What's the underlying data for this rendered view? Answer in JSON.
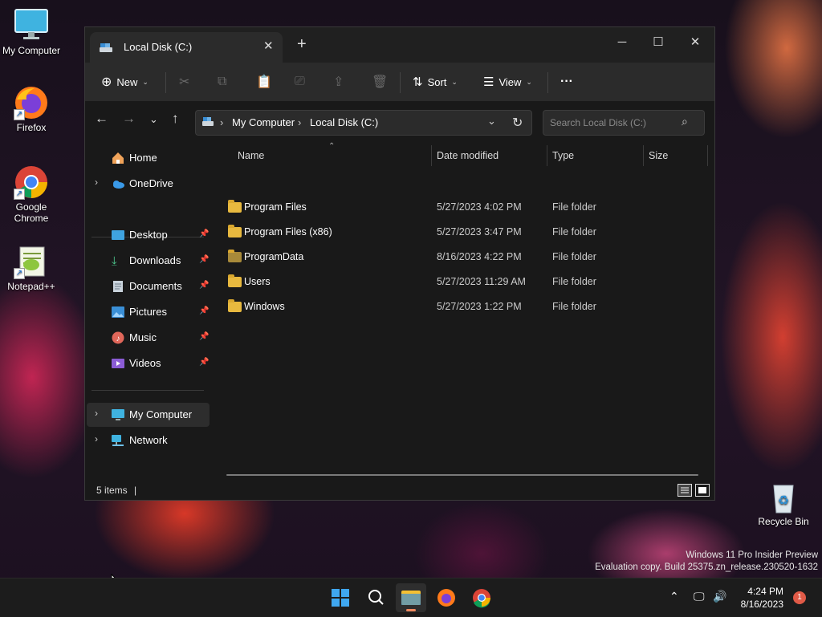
{
  "desktop": {
    "icons": [
      {
        "label": "My Computer"
      },
      {
        "label": "Firefox"
      },
      {
        "label": "Google Chrome"
      },
      {
        "label": "Notepad++"
      },
      {
        "label": "Recycle Bin"
      }
    ]
  },
  "watermark": {
    "line1": "Windows 11 Pro Insider Preview",
    "line2": "Evaluation copy. Build 25375.zn_release.230520-1632"
  },
  "explorer": {
    "tab_title": "Local Disk (C:)",
    "toolbar": {
      "new_label": "New",
      "sort_label": "Sort",
      "view_label": "View",
      "more_label": "···"
    },
    "breadcrumb": [
      "My Computer",
      "Local Disk (C:)"
    ],
    "search_placeholder": "Search Local Disk (C:)",
    "nav": {
      "home": "Home",
      "onedrive": "OneDrive",
      "quick_access": [
        "Desktop",
        "Downloads",
        "Documents",
        "Pictures",
        "Music",
        "Videos"
      ],
      "my_computer": "My Computer",
      "network": "Network"
    },
    "columns": {
      "name": "Name",
      "date": "Date modified",
      "type": "Type",
      "size": "Size"
    },
    "files": [
      {
        "name": "Program Files",
        "date": "5/27/2023 4:02 PM",
        "type": "File folder"
      },
      {
        "name": "Program Files (x86)",
        "date": "5/27/2023 3:47 PM",
        "type": "File folder"
      },
      {
        "name": "ProgramData",
        "date": "8/16/2023 4:22 PM",
        "type": "File folder"
      },
      {
        "name": "Users",
        "date": "5/27/2023 11:29 AM",
        "type": "File folder"
      },
      {
        "name": "Windows",
        "date": "5/27/2023 1:22 PM",
        "type": "File folder"
      }
    ],
    "status": "5 items"
  },
  "taskbar": {
    "time": "4:24 PM",
    "date": "8/16/2023",
    "notification_count": "1"
  },
  "colors": {
    "folder": "#e8b93f",
    "accent": "#1a6fd0",
    "window_bg": "#191919"
  }
}
